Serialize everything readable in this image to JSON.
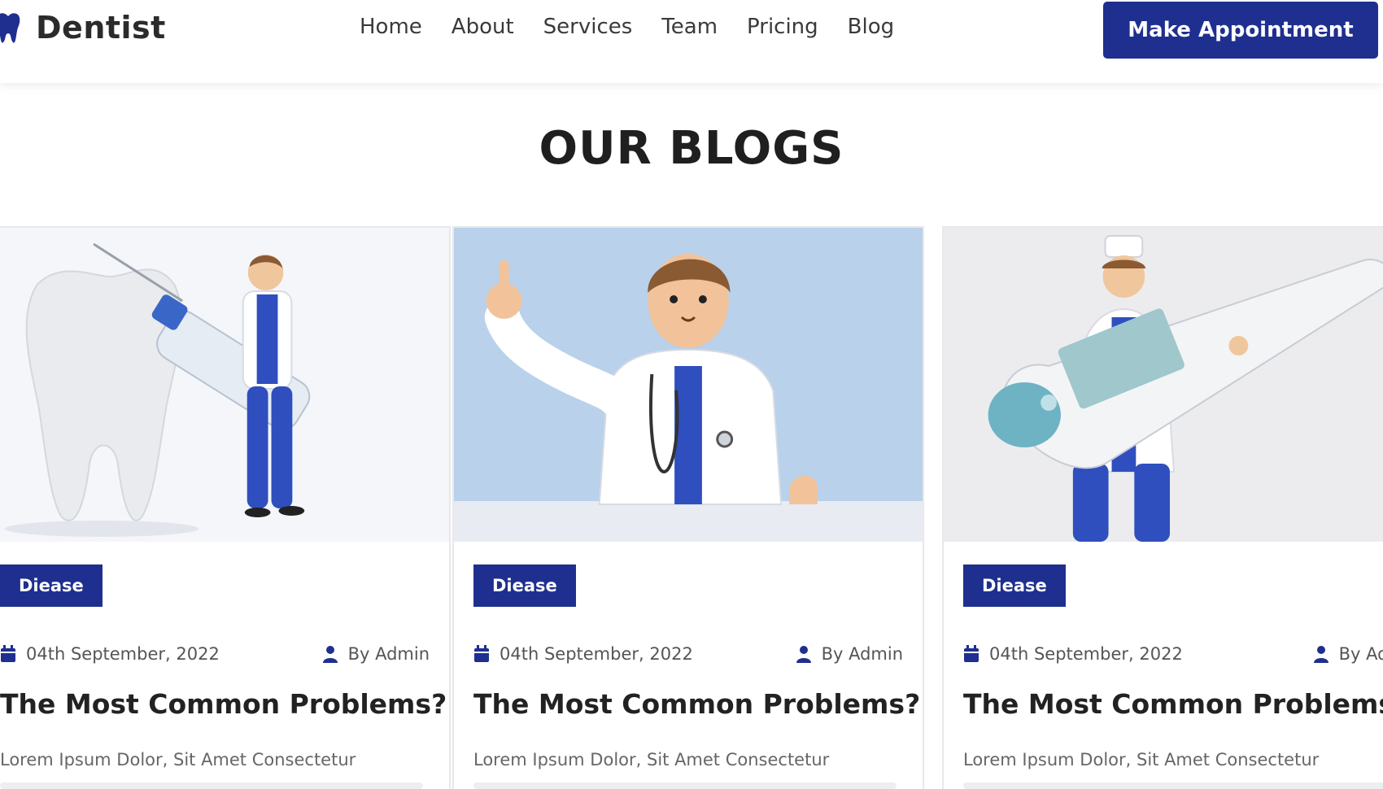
{
  "header": {
    "brand": "Dentist",
    "nav": [
      "Home",
      "About",
      "Services",
      "Team",
      "Pricing",
      "Blog"
    ],
    "cta": "Make Appointment"
  },
  "section": {
    "title": "OUR BLOGS"
  },
  "cards": [
    {
      "tag": "Diease",
      "date": "04th September, 2022",
      "author": "By Admin",
      "title": "The Most Common Problems?",
      "excerpt": "Lorem Ipsum Dolor, Sit Amet Consectetur"
    },
    {
      "tag": "Diease",
      "date": "04th September, 2022",
      "author": "By Admin",
      "title": "The Most Common Problems?",
      "excerpt": "Lorem Ipsum Dolor, Sit Amet Consectetur"
    },
    {
      "tag": "Diease",
      "date": "04th September, 2022",
      "author": "By Admin",
      "title": "The Most Common Problems?",
      "excerpt": "Lorem Ipsum Dolor, Sit Amet Consectetur"
    }
  ],
  "colors": {
    "primary": "#1f2f8f",
    "text": "#222222",
    "muted": "#666666"
  },
  "icons": {
    "logo": "tooth-icon",
    "date": "calendar-icon",
    "author": "user-icon"
  }
}
